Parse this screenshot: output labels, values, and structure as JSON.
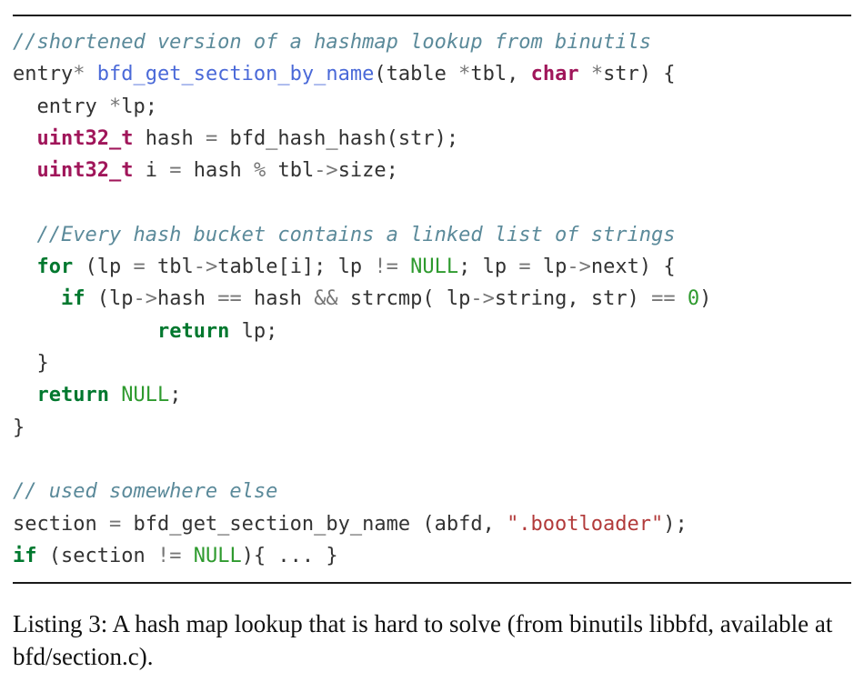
{
  "listing": {
    "lines": [
      {
        "tokens": [
          {
            "text": "//shortened version of a hashmap lookup from binutils",
            "kind": "comment"
          }
        ]
      },
      {
        "tokens": [
          {
            "text": "entry",
            "kind": "plain"
          },
          {
            "text": "*",
            "kind": "operator"
          },
          {
            "text": " ",
            "kind": "plain"
          },
          {
            "text": "bfd_get_section_by_name",
            "kind": "func"
          },
          {
            "text": "(table ",
            "kind": "plain"
          },
          {
            "text": "*",
            "kind": "operator"
          },
          {
            "text": "tbl, ",
            "kind": "plain"
          },
          {
            "text": "char",
            "kind": "type"
          },
          {
            "text": " ",
            "kind": "plain"
          },
          {
            "text": "*",
            "kind": "operator"
          },
          {
            "text": "str) {",
            "kind": "plain"
          }
        ]
      },
      {
        "tokens": [
          {
            "text": "  entry ",
            "kind": "plain"
          },
          {
            "text": "*",
            "kind": "operator"
          },
          {
            "text": "lp;",
            "kind": "plain"
          }
        ]
      },
      {
        "tokens": [
          {
            "text": "  ",
            "kind": "plain"
          },
          {
            "text": "uint32_t",
            "kind": "type"
          },
          {
            "text": " hash ",
            "kind": "plain"
          },
          {
            "text": "=",
            "kind": "operator"
          },
          {
            "text": " bfd_hash_hash(str);",
            "kind": "plain"
          }
        ]
      },
      {
        "tokens": [
          {
            "text": "  ",
            "kind": "plain"
          },
          {
            "text": "uint32_t",
            "kind": "type"
          },
          {
            "text": " i ",
            "kind": "plain"
          },
          {
            "text": "=",
            "kind": "operator"
          },
          {
            "text": " hash ",
            "kind": "plain"
          },
          {
            "text": "%",
            "kind": "operator"
          },
          {
            "text": " tbl",
            "kind": "plain"
          },
          {
            "text": "->",
            "kind": "operator"
          },
          {
            "text": "size;",
            "kind": "plain"
          }
        ]
      },
      {
        "tokens": []
      },
      {
        "tokens": [
          {
            "text": "  //Every hash bucket contains a linked list of strings",
            "kind": "comment"
          }
        ]
      },
      {
        "tokens": [
          {
            "text": "  ",
            "kind": "plain"
          },
          {
            "text": "for",
            "kind": "keyword"
          },
          {
            "text": " (lp ",
            "kind": "plain"
          },
          {
            "text": "=",
            "kind": "operator"
          },
          {
            "text": " tbl",
            "kind": "plain"
          },
          {
            "text": "->",
            "kind": "operator"
          },
          {
            "text": "table[i]; lp ",
            "kind": "plain"
          },
          {
            "text": "!=",
            "kind": "operator"
          },
          {
            "text": " ",
            "kind": "plain"
          },
          {
            "text": "NULL",
            "kind": "constant"
          },
          {
            "text": "; lp ",
            "kind": "plain"
          },
          {
            "text": "=",
            "kind": "operator"
          },
          {
            "text": " lp",
            "kind": "plain"
          },
          {
            "text": "->",
            "kind": "operator"
          },
          {
            "text": "next) {",
            "kind": "plain"
          }
        ]
      },
      {
        "tokens": [
          {
            "text": "    ",
            "kind": "plain"
          },
          {
            "text": "if",
            "kind": "keyword"
          },
          {
            "text": " (lp",
            "kind": "plain"
          },
          {
            "text": "->",
            "kind": "operator"
          },
          {
            "text": "hash ",
            "kind": "plain"
          },
          {
            "text": "==",
            "kind": "operator"
          },
          {
            "text": " hash ",
            "kind": "plain"
          },
          {
            "text": "&&",
            "kind": "operator"
          },
          {
            "text": " strcmp( lp",
            "kind": "plain"
          },
          {
            "text": "->",
            "kind": "operator"
          },
          {
            "text": "string, str) ",
            "kind": "plain"
          },
          {
            "text": "==",
            "kind": "operator"
          },
          {
            "text": " ",
            "kind": "plain"
          },
          {
            "text": "0",
            "kind": "constant"
          },
          {
            "text": ")",
            "kind": "plain"
          }
        ]
      },
      {
        "tokens": [
          {
            "text": "            ",
            "kind": "plain"
          },
          {
            "text": "return",
            "kind": "keyword"
          },
          {
            "text": " lp;",
            "kind": "plain"
          }
        ]
      },
      {
        "tokens": [
          {
            "text": "  }",
            "kind": "plain"
          }
        ]
      },
      {
        "tokens": [
          {
            "text": "  ",
            "kind": "plain"
          },
          {
            "text": "return",
            "kind": "keyword"
          },
          {
            "text": " ",
            "kind": "plain"
          },
          {
            "text": "NULL",
            "kind": "constant"
          },
          {
            "text": ";",
            "kind": "plain"
          }
        ]
      },
      {
        "tokens": [
          {
            "text": "}",
            "kind": "plain"
          }
        ]
      },
      {
        "tokens": []
      },
      {
        "tokens": [
          {
            "text": "// used somewhere else",
            "kind": "comment"
          }
        ]
      },
      {
        "tokens": [
          {
            "text": "section ",
            "kind": "plain"
          },
          {
            "text": "=",
            "kind": "operator"
          },
          {
            "text": " bfd_get_section_by_name (abfd, ",
            "kind": "plain"
          },
          {
            "text": "\".bootloader\"",
            "kind": "string"
          },
          {
            "text": ");",
            "kind": "plain"
          }
        ]
      },
      {
        "tokens": [
          {
            "text": "if",
            "kind": "keyword"
          },
          {
            "text": " (section ",
            "kind": "plain"
          },
          {
            "text": "!=",
            "kind": "operator"
          },
          {
            "text": " ",
            "kind": "plain"
          },
          {
            "text": "NULL",
            "kind": "constant"
          },
          {
            "text": "){ ... }",
            "kind": "plain"
          }
        ]
      }
    ]
  },
  "caption": {
    "text": "Listing 3: A hash map lookup that is hard to solve (from binutils libbfd, available at bfd/section.c)."
  },
  "colors": {
    "comment": "#5b8a9a",
    "keyword": "#00782e",
    "type": "#a0165a",
    "function": "#4a69d8",
    "constant": "#2e9a2e",
    "string": "#b23a3a",
    "operator": "#777777",
    "text": "#333333"
  }
}
